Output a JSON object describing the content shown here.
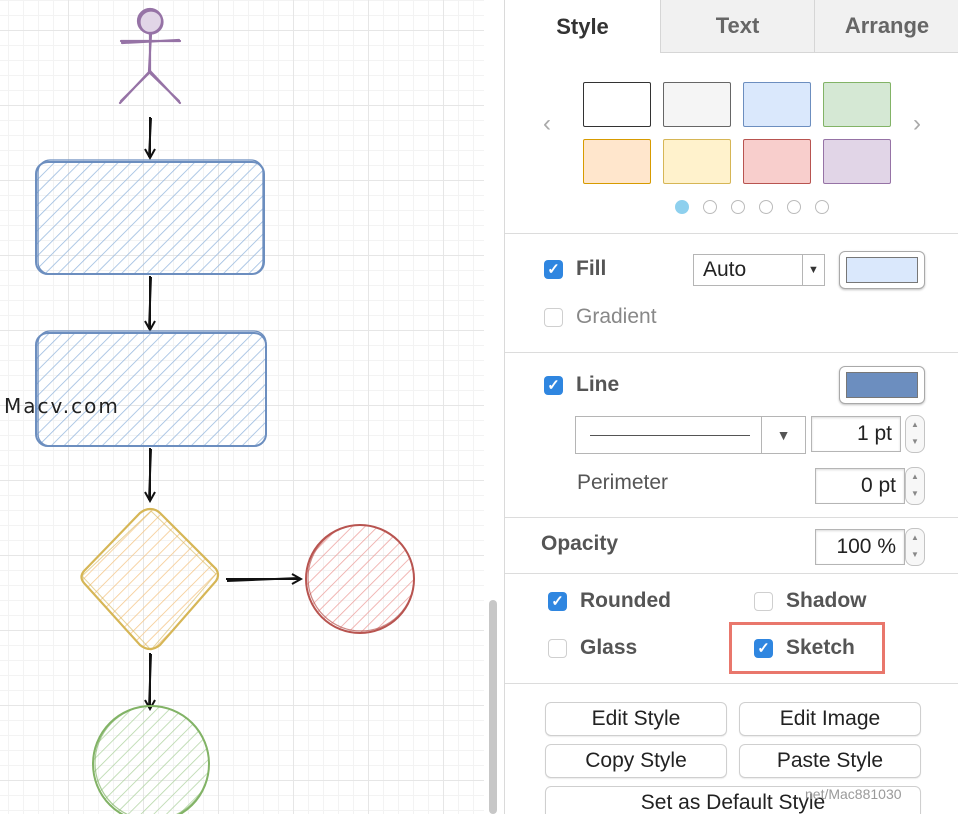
{
  "watermark": {
    "text": "Macv.com",
    "url": "net/Mac881030"
  },
  "tabs": [
    {
      "label": "Style",
      "active": true
    },
    {
      "label": "Text",
      "active": false
    },
    {
      "label": "Arrange",
      "active": false
    }
  ],
  "swatches": [
    "#ffffff",
    "#f5f5f5",
    "#dae8fc",
    "#d5e8d4",
    "#ffe6cc",
    "#fff2cc",
    "#f8cecc",
    "#e1d5e7"
  ],
  "swatch_pages": {
    "count": 6,
    "current": 1
  },
  "fill": {
    "label": "Fill",
    "checked": true,
    "mode": "Auto",
    "color": "#dae8fc"
  },
  "gradient": {
    "label": "Gradient",
    "checked": false
  },
  "line": {
    "label": "Line",
    "checked": true,
    "color": "#6c8ebf",
    "width": "1 pt"
  },
  "perimeter": {
    "label": "Perimeter",
    "value": "0 pt"
  },
  "opacity": {
    "label": "Opacity",
    "value": "100 %"
  },
  "options": {
    "rounded": {
      "label": "Rounded",
      "checked": true
    },
    "shadow": {
      "label": "Shadow",
      "checked": false
    },
    "glass": {
      "label": "Glass",
      "checked": false
    },
    "sketch": {
      "label": "Sketch",
      "checked": true
    }
  },
  "buttons": {
    "edit_style": "Edit Style",
    "edit_image": "Edit Image",
    "copy_style": "Copy Style",
    "paste_style": "Paste Style",
    "set_default": "Set as Default Style"
  }
}
